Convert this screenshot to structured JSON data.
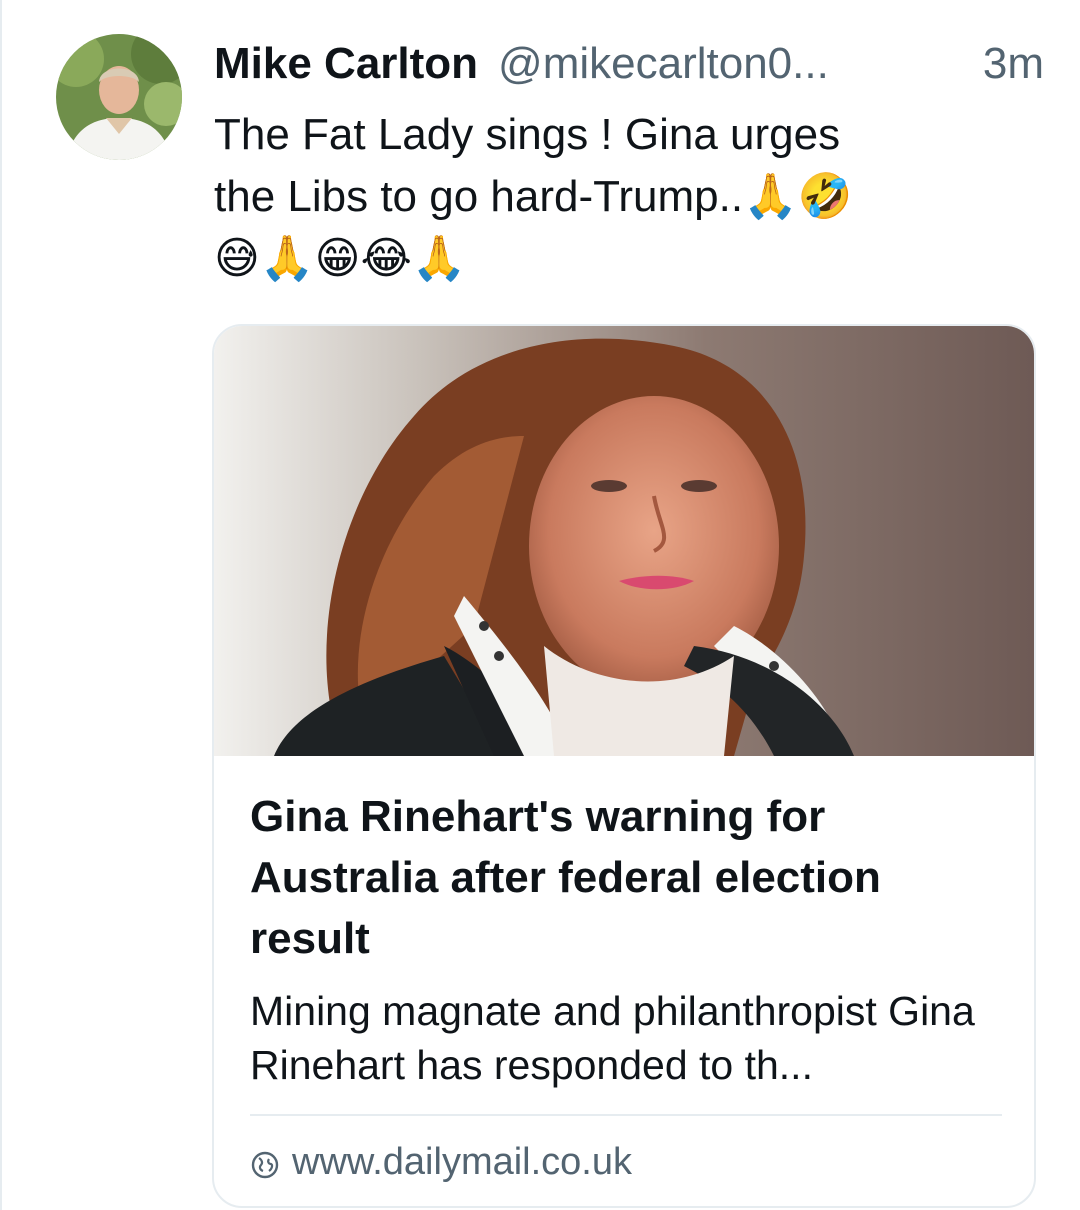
{
  "post": {
    "author": {
      "display_name": "Mike Carlton",
      "handle": "@mikecarlton0...",
      "avatar_icon": "profile-photo"
    },
    "timestamp": "3m",
    "text_lines": [
      "The Fat Lady sings !  Gina urges",
      "the Libs to go hard-Trump..🙏🤣",
      "😅🙏😁😂🙏"
    ]
  },
  "link_card": {
    "image_alt": "news-photo",
    "title": "Gina Rinehart's warning for Australia after federal election result",
    "description": "Mining magnate and philanthropist Gina Rinehart has responded to th...",
    "domain": "www.dailymail.co.uk",
    "domain_icon": "globe-icon"
  },
  "colors": {
    "text_primary": "#0f1419",
    "text_secondary": "#536471",
    "border": "#e6ecf0"
  }
}
